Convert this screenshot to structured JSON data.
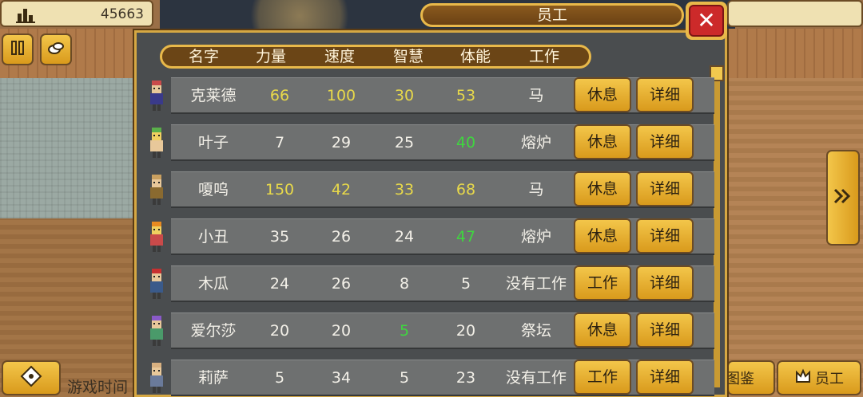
{
  "hud": {
    "gold_value": "45663",
    "game_time_label": "游戏时间",
    "staff_button_label": "员工",
    "bottom_mid_label": "图鉴"
  },
  "dialog": {
    "title": "员工",
    "columns": [
      "名字",
      "力量",
      "速度",
      "智慧",
      "体能",
      "工作"
    ]
  },
  "staff": [
    {
      "name": "克莱德",
      "str": "66",
      "spd": "100",
      "int": "30",
      "sta": "53",
      "job": "马",
      "action": "休息",
      "detail": "详细",
      "str_color": "yellow",
      "spd_color": "yellow",
      "int_color": "yellow",
      "sta_color": "yellow"
    },
    {
      "name": "叶子",
      "str": "7",
      "spd": "29",
      "int": "25",
      "sta": "40",
      "job": "熔炉",
      "action": "休息",
      "detail": "详细",
      "str_color": "white",
      "spd_color": "white",
      "int_color": "white",
      "sta_color": "green"
    },
    {
      "name": "嗄呜",
      "str": "150",
      "spd": "42",
      "int": "33",
      "sta": "68",
      "job": "马",
      "action": "休息",
      "detail": "详细",
      "str_color": "yellow",
      "spd_color": "yellow",
      "int_color": "yellow",
      "sta_color": "yellow"
    },
    {
      "name": "小丑",
      "str": "35",
      "spd": "26",
      "int": "24",
      "sta": "47",
      "job": "熔炉",
      "action": "休息",
      "detail": "详细",
      "str_color": "white",
      "spd_color": "white",
      "int_color": "white",
      "sta_color": "green"
    },
    {
      "name": "木瓜",
      "str": "24",
      "spd": "26",
      "int": "8",
      "sta": "5",
      "job": "没有工作",
      "action": "工作",
      "detail": "详细",
      "str_color": "white",
      "spd_color": "white",
      "int_color": "white",
      "sta_color": "white"
    },
    {
      "name": "爱尔莎",
      "str": "20",
      "spd": "20",
      "int": "5",
      "sta": "20",
      "job": "祭坛",
      "action": "休息",
      "detail": "详细",
      "str_color": "white",
      "spd_color": "white",
      "int_color": "green",
      "sta_color": "white"
    },
    {
      "name": "莉萨",
      "str": "5",
      "spd": "34",
      "int": "5",
      "sta": "23",
      "job": "没有工作",
      "action": "工作",
      "detail": "详细",
      "str_color": "white",
      "spd_color": "white",
      "int_color": "white",
      "sta_color": "white"
    }
  ],
  "colors": {
    "yellow": "#e8d94a",
    "green": "#3fd63f",
    "panel": "#4a4d4f",
    "gold_button": "#f3c64a",
    "close_red": "#cc2a2a"
  },
  "icons": {
    "gold": "bar-chart-icon",
    "pause": "pause-icon",
    "items": "bag-icon",
    "next": "double-chevron-right-icon",
    "dpad": "dpad-icon",
    "staff": "crown-icon",
    "close": "close-icon"
  }
}
